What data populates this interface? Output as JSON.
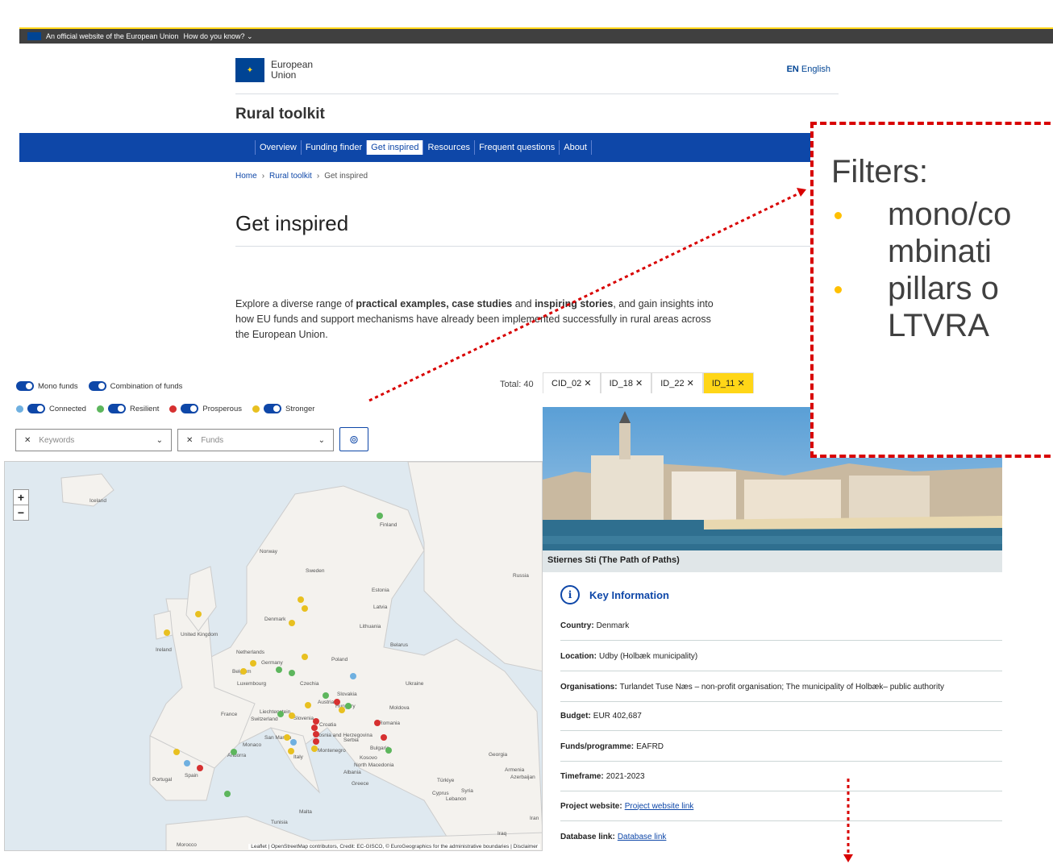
{
  "topbar": {
    "text": "An official website of the European Union",
    "howto": "How do you know?"
  },
  "header": {
    "logo_line1": "European",
    "logo_line2": "Union",
    "lang_code": "EN",
    "lang_name": "English"
  },
  "site_name": "Rural toolkit",
  "nav": [
    "Overview",
    "Funding finder",
    "Get inspired",
    "Resources",
    "Frequent questions",
    "About"
  ],
  "breadcrumb": {
    "home": "Home",
    "parent": "Rural toolkit",
    "current": "Get inspired"
  },
  "page_title": "Get inspired",
  "intro": {
    "p1": "Explore a diverse range of ",
    "b1": "practical examples, case studies",
    "p2": " and ",
    "b2": "inspiring stories",
    "p3": ", and gain insights into how EU funds and support mechanisms have already been implemented successfully in rural areas across the European Union."
  },
  "filters": {
    "mono": "Mono funds",
    "combination": "Combination of funds",
    "connected": "Connected",
    "resilient": "Resilient",
    "prosperous": "Prosperous",
    "stronger": "Stronger",
    "keywords_placeholder": "Keywords",
    "funds_placeholder": "Funds",
    "colors": {
      "connected": "#6fb0e0",
      "resilient": "#5db65d",
      "prosperous": "#d63030",
      "stronger": "#e8c020"
    }
  },
  "total": "Total: 40",
  "tabs": [
    "CID_02 ✕",
    "ID_18 ✕",
    "ID_22 ✕",
    "ID_11 ✕"
  ],
  "map": {
    "countries": [
      "Iceland",
      "Finland",
      "Norway",
      "Sweden",
      "Estonia",
      "Latvia",
      "Russia",
      "Denmark",
      "Lithuania",
      "United Kingdom",
      "Ireland",
      "Netherlands",
      "Belarus",
      "Poland",
      "Germany",
      "Belgium",
      "Luxembourg",
      "Czechia",
      "Ukraine",
      "Slovakia",
      "Austria",
      "Hungary",
      "Moldova",
      "Liechtenstein",
      "France",
      "Switzerland",
      "Slovenia",
      "Croatia",
      "Romania",
      "Bosnia and Herzegovina",
      "Serbia",
      "San Marino",
      "Monaco",
      "Montenegro",
      "Bulgaria",
      "Andorra",
      "Italy",
      "Kosovo",
      "North Macedonia",
      "Georgia",
      "Spain",
      "Portugal",
      "Albania",
      "Armenia",
      "Azerbaijan",
      "Greece",
      "Türkiye",
      "Malta",
      "Cyprus",
      "Syria",
      "Lebanon",
      "Tunisia",
      "Iran",
      "Iraq",
      "Morocco"
    ],
    "attribution": "Leaflet | OpenStreetMap contributors, Credit: EC-GISCO, © EuroGeographics for the administrative boundaries | Disclaimer"
  },
  "project": {
    "title": "Stiernes Sti (The Path of Paths)",
    "heading": "Key Information",
    "rows": [
      {
        "label": "Country:",
        "value": "Denmark"
      },
      {
        "label": "Location:",
        "value": "Udby  (Holbæk municipality)"
      },
      {
        "label": "Organisations:",
        "value": "Turlandet Tuse Næs – non-profit organisation; The municipality of Holbæk– public authority"
      },
      {
        "label": "Budget:",
        "value": "EUR 402,687"
      },
      {
        "label": "Funds/programme:",
        "value": "EAFRD"
      },
      {
        "label": "Timeframe:",
        "value": "2021-2023"
      },
      {
        "label": "Project website:",
        "value": "Project website link"
      },
      {
        "label": "Database link:",
        "value": "Database link"
      }
    ]
  },
  "callout": {
    "title": "Filters:",
    "items": [
      "mono/co mbinati",
      "pillars o LTVRA"
    ]
  }
}
